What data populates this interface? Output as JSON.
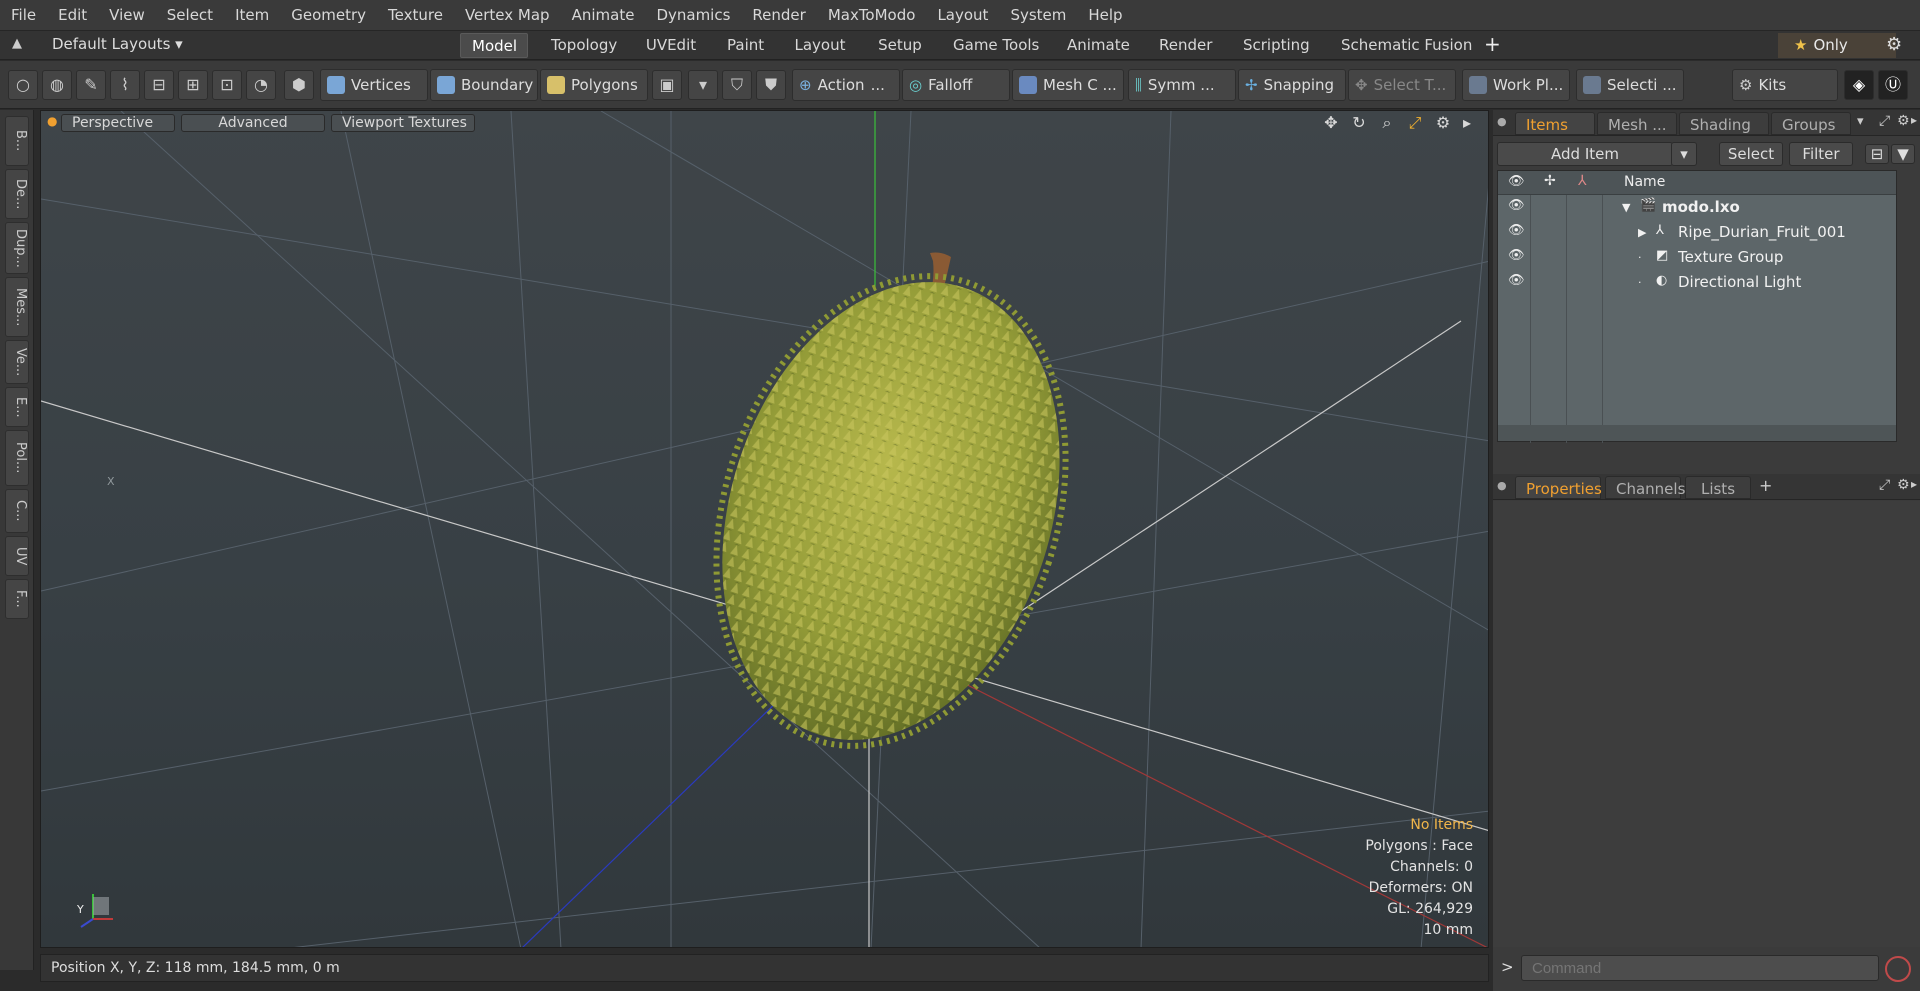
{
  "menu": [
    "File",
    "Edit",
    "View",
    "Select",
    "Item",
    "Geometry",
    "Texture",
    "Vertex Map",
    "Animate",
    "Dynamics",
    "Render",
    "MaxToModo",
    "Layout",
    "System",
    "Help"
  ],
  "layout": {
    "dropdown": "Default Layouts",
    "tabs": [
      "Model",
      "Topology",
      "UVEdit",
      "Paint",
      "Layout",
      "Setup",
      "Game Tools",
      "Animate",
      "Render",
      "Scripting",
      "Schematic Fusion"
    ],
    "active_tab": "Model",
    "add": "+",
    "only_label": "Only"
  },
  "toolbar": {
    "vertices": "Vertices",
    "boundary": "Boundary",
    "polygons": "Polygons",
    "action": "Action",
    "action_more": "...",
    "falloff": "Falloff",
    "mesh_c": "Mesh C ...",
    "symm": "Symm ...",
    "snapping": "Snapping",
    "select_t": "Select T...",
    "work_pl": "Work Pl...",
    "selecti": "Selecti ...",
    "kits": "Kits"
  },
  "left_tabs": [
    "B...",
    "De...",
    "Dup...",
    "Mes...",
    "Ve...",
    "E...",
    "Pol...",
    "C...",
    "UV",
    "F..."
  ],
  "viewport": {
    "view_mode": "Perspective",
    "advanced": "Advanced",
    "viewport_textures": "Viewport Textures",
    "hud": {
      "items": "No Items",
      "polygons": "Polygons : Face",
      "channels": "Channels: 0",
      "deformers": "Deformers: ON",
      "gl": "GL: 264,929",
      "scale": "10 mm"
    },
    "axis_x": "X",
    "axis_y": "Y"
  },
  "status": {
    "position": "Position X, Y, Z:  118 mm, 184.5 mm, 0 m"
  },
  "items_panel": {
    "tabs": [
      "Items",
      "Mesh ...",
      "Shading",
      "Groups"
    ],
    "add_item": "Add Item",
    "select": "Select",
    "filter": "Filter",
    "column_name": "Name",
    "rows": [
      {
        "label": "modo.lxo",
        "bold": true
      },
      {
        "label": "Ripe_Durian_Fruit_001",
        "bold": false
      },
      {
        "label": "Texture Group",
        "bold": false
      },
      {
        "label": "Directional Light",
        "bold": false
      }
    ]
  },
  "props_panel": {
    "tabs": [
      "Properties",
      "Channels",
      "Lists"
    ],
    "add": "+"
  },
  "command": {
    "placeholder": "Command",
    "prompt": ">"
  },
  "colors": {
    "accent": "#f0a030",
    "axis_x": "#d03a3a",
    "axis_y": "#3ac03a",
    "axis_z": "#2a4ad0",
    "durian": "#9aa23a"
  }
}
